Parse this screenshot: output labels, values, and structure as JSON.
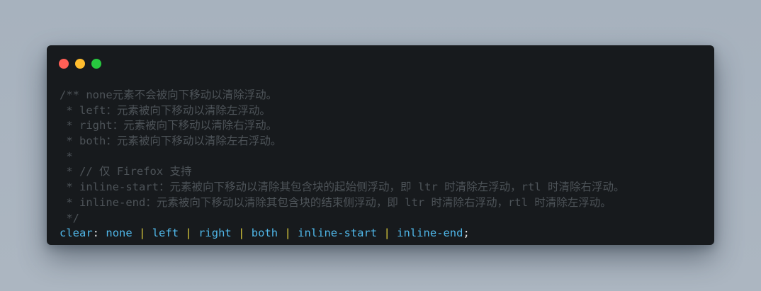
{
  "window": {
    "controls": [
      "close",
      "minimize",
      "maximize"
    ],
    "colors": {
      "close": "#ff5f56",
      "minimize": "#ffbd2e",
      "maximize": "#27c93f",
      "background": "#171a1d",
      "comment": "#4d5358",
      "value": "#4fb6e8",
      "pipe": "#d6c73a"
    }
  },
  "code": {
    "comment_lines": [
      "/** none元素不会被向下移动以清除浮动。",
      " * left：元素被向下移动以清除左浮动。",
      " * right：元素被向下移动以清除右浮动。",
      " * both：元素被向下移动以清除左右浮动。",
      " *",
      " * // 仅 Firefox 支持",
      " * inline-start：元素被向下移动以清除其包含块的起始侧浮动，即 ltr 时清除左浮动，rtl 时清除右浮动。",
      " * inline-end：元素被向下移动以清除其包含块的结束侧浮动，即 ltr 时清除右浮动，rtl 时清除左浮动。",
      " */"
    ],
    "declaration": {
      "property": "clear",
      "colon": ":",
      "values": [
        "none",
        "left",
        "right",
        "both",
        "inline-start",
        "inline-end"
      ],
      "separator": "|",
      "terminator": ";"
    }
  }
}
